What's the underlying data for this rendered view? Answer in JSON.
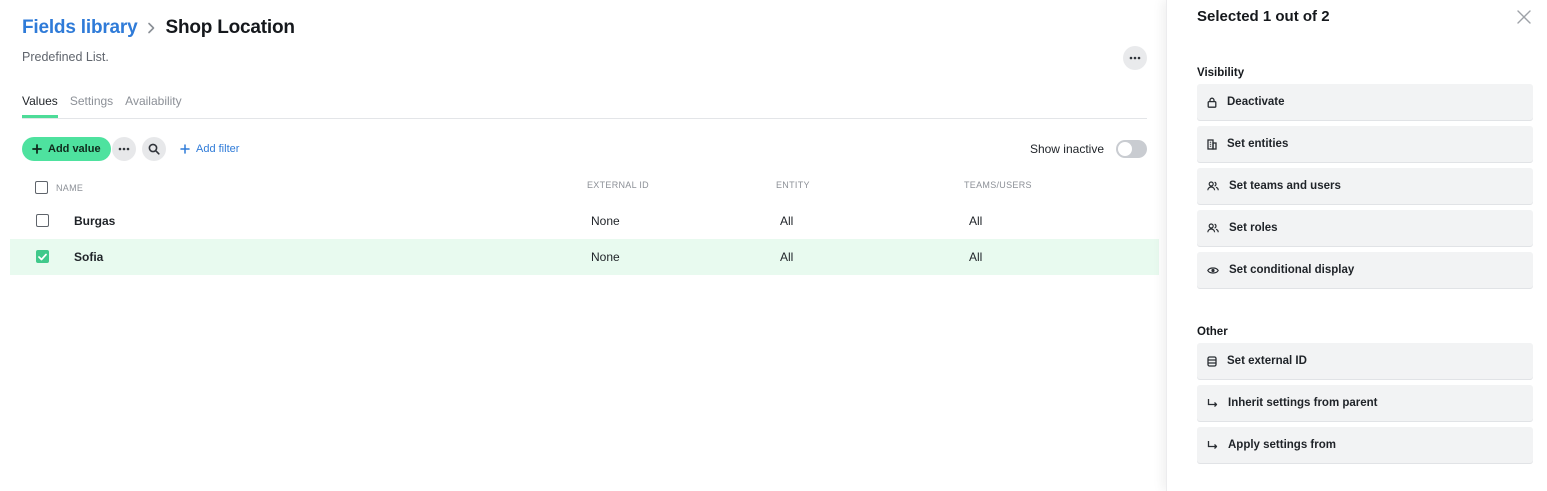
{
  "header": {
    "breadcrumb_link": "Fields library",
    "breadcrumb_current": "Shop Location",
    "subtitle": "Predefined List."
  },
  "tabs": [
    {
      "label": "Values",
      "active": true
    },
    {
      "label": "Settings",
      "active": false
    },
    {
      "label": "Availability",
      "active": false
    }
  ],
  "toolbar": {
    "add_value_label": "Add value",
    "add_filter_label": "Add filter",
    "show_inactive_label": "Show inactive",
    "show_inactive_on": false
  },
  "table": {
    "columns": [
      "NAME",
      "EXTERNAL ID",
      "ENTITY",
      "TEAMS/USERS"
    ],
    "rows": [
      {
        "name": "Burgas",
        "external_id": "None",
        "entity": "All",
        "teams_users": "All",
        "checked": false
      },
      {
        "name": "Sofia",
        "external_id": "None",
        "entity": "All",
        "teams_users": "All",
        "checked": true
      }
    ]
  },
  "panel": {
    "title": "Selected 1 out of 2",
    "visibility_label": "Visibility",
    "visibility_actions": [
      {
        "label": "Deactivate",
        "icon": "lock-icon"
      },
      {
        "label": "Set entities",
        "icon": "building-icon"
      },
      {
        "label": "Set teams and users",
        "icon": "users-icon"
      },
      {
        "label": "Set roles",
        "icon": "users-icon"
      },
      {
        "label": "Set conditional display",
        "icon": "eye-icon"
      }
    ],
    "other_label": "Other",
    "other_actions": [
      {
        "label": "Set external ID",
        "icon": "database-icon"
      },
      {
        "label": "Inherit settings from parent",
        "icon": "arrow-down-right-icon"
      },
      {
        "label": "Apply settings from",
        "icon": "arrow-down-right-icon"
      }
    ]
  },
  "colors": {
    "accent_green": "#4ee29f",
    "link_blue": "#2f7bd8",
    "selected_row": "#e8faef"
  }
}
